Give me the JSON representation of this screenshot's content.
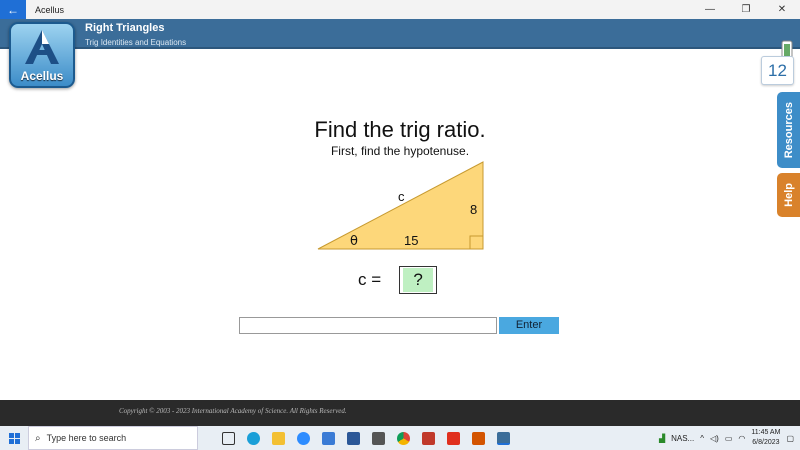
{
  "window": {
    "title": "Acellus",
    "back_icon": "arrow-left-icon",
    "controls": [
      "—",
      "❐",
      "✕"
    ]
  },
  "header": {
    "title": "Right Triangles",
    "subtitle": "Trig Identities and Equations",
    "logo_text": "Acellus",
    "accent": "#3b6d99"
  },
  "sidebar": {
    "page_number": "12",
    "resources_label": "Resources",
    "help_label": "Help"
  },
  "question": {
    "title": "Find the trig ratio.",
    "subtitle": "First, find the hypotenuse.",
    "triangle": {
      "hypotenuse_label": "c",
      "opposite_label": "8",
      "adjacent_label": "15",
      "angle_label": "θ",
      "fill": "#fdd77a"
    },
    "equation_lhs": "c =",
    "equation_answer": "?"
  },
  "answer": {
    "input_value": "",
    "enter_label": "Enter"
  },
  "footer": {
    "copyright": "Copyright © 2003 - 2023 International Academy of Science.  All Rights Reserved."
  },
  "taskbar": {
    "search_placeholder": "Type here to search",
    "tray_label": "NAS...",
    "time": "11:45 AM",
    "date": "6/8/2023"
  }
}
